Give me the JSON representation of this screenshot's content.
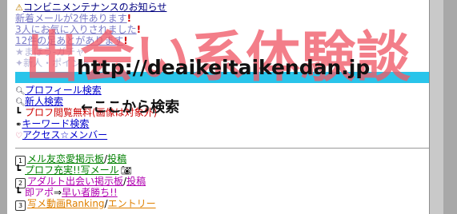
{
  "notices": {
    "maintenance": "コンビニメンテナンスのお知らせ",
    "new_mail": "新着メールが2件あります",
    "favorites": "3人にお気に入りされました",
    "footprints": "12件の足あとがあります"
  },
  "faded": {
    "line1": "まほう-ガチャ",
    "line2": "新人・ポイント"
  },
  "menu": {
    "profile_search": "プロフィール検索",
    "new_search": "新人検索",
    "profile_free": "プロフ閲覧無料(画像は対象外)",
    "keyword_search": "キーワード検索",
    "access_members": "アクセス☆メンバー"
  },
  "boards": {
    "b1_label": "メル友恋愛掲示板",
    "b1_post": "投稿",
    "b1_sub": "プロフ充実!!写メール",
    "b2_label": "アダルト出会い掲示板",
    "b2_post": "投稿",
    "b2_sub_prefix": "即アポ",
    "b2_sub_link": "早い者勝ち!!",
    "b3_label": "写メ動画Ranking",
    "b3_entry": "エントリー",
    "slash": "/"
  },
  "watermark": {
    "jp": "出会い系体験談",
    "url": "http://deaikeitaikendan.jp"
  },
  "annotation": "←ここから検索",
  "icons": {
    "warning": "warning-icon",
    "search": "magnifier-icon",
    "number1": "1",
    "number2": "2",
    "number3": "3"
  },
  "colors": {
    "bar": "#29c4ea",
    "watermark": "#f05a68",
    "exclaim": "#d00000"
  }
}
